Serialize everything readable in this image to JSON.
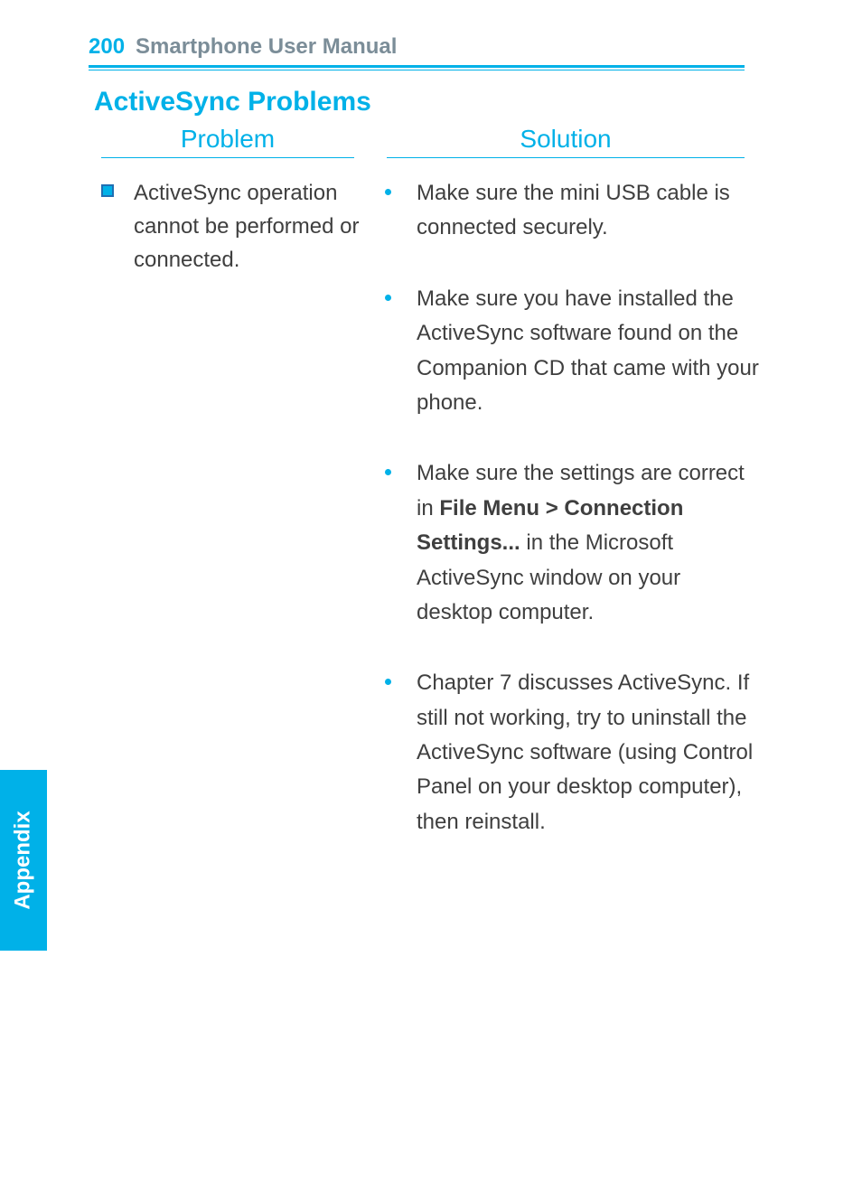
{
  "header": {
    "page_number": "200",
    "manual_title": "Smartphone User Manual"
  },
  "section_title": "ActiveSync Problems",
  "column_headers": {
    "problem": "Problem",
    "solution": "Solution"
  },
  "problem": {
    "items": [
      "ActiveSync operation cannot be performed or connected."
    ]
  },
  "solution": {
    "items": [
      {
        "pre": "Make sure the mini USB cable is connected securely."
      },
      {
        "pre": "Make sure you have installed the ActiveSync software found on the Companion CD that came with your phone."
      },
      {
        "pre": "Make sure the settings are correct in ",
        "bold": "File Menu > Connection Settings...",
        "post": " in the Microsoft ActiveSync window on your desktop computer."
      },
      {
        "pre": "Chapter 7 discusses ActiveSync. If still not working, try to uninstall the ActiveSync software (using Control Panel on your desktop computer), then reinstall."
      }
    ]
  },
  "side_tab": "Appendix"
}
